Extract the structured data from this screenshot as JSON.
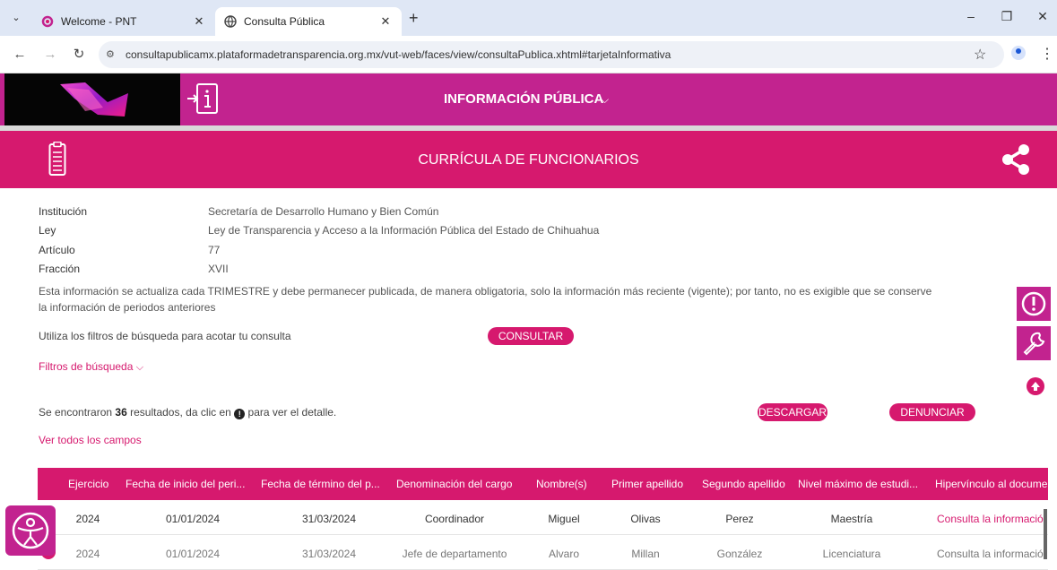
{
  "browser": {
    "tabs": [
      {
        "label": "Welcome - PNT",
        "active": false
      },
      {
        "label": "Consulta Pública",
        "active": true
      }
    ],
    "url": "consultapublicamx.plataformadetransparencia.org.mx/vut-web/faces/view/consultaPublica.xhtml#tarjetaInformativa"
  },
  "header": {
    "nav_label": "INFORMACIÓN PÚBLICA"
  },
  "banner": {
    "title": "CURRÍCULA DE FUNCIONARIOS"
  },
  "info": {
    "institucion_label": "Institución",
    "institucion_value": "Secretaría de Desarrollo Humano y Bien Común",
    "ley_label": "Ley",
    "ley_value": "Ley de Transparencia y Acceso a la Información Pública del Estado de Chihuahua",
    "articulo_label": "Artículo",
    "articulo_value": "77",
    "fraccion_label": "Fracción",
    "fraccion_value": "XVII",
    "note": "Esta información se actualiza cada TRIMESTRE y debe permanecer publicada, de manera obligatoria, solo la información más reciente (vigente); por tanto, no es exigible que se conserve la información de periodos anteriores"
  },
  "filters": {
    "hint": "Utiliza los filtros de búsqueda para acotar tu consulta",
    "consultar_label": "CONSULTAR",
    "toggle_label": "Filtros de búsqueda"
  },
  "results": {
    "prefix": "Se encontraron",
    "count": "36",
    "middle": "resultados, da clic en",
    "suffix": "para ver el detalle.",
    "descargar_label": "DESCARGAR",
    "denunciar_label": "DENUNCIAR",
    "ver_todos_label": "Ver todos los campos"
  },
  "table": {
    "headers": [
      "Ejercicio",
      "Fecha de inicio del peri...",
      "Fecha de término del p...",
      "Denominación del cargo",
      "Nombre(s)",
      "Primer apellido",
      "Segundo apellido",
      "Nivel máximo de estudi...",
      "Hipervínculo al docume..."
    ],
    "rows": [
      [
        "2024",
        "01/01/2024",
        "31/03/2024",
        "Coordinador",
        "Miguel",
        "Olivas",
        "Perez",
        "Maestría",
        "Consulta la información"
      ],
      [
        "2024",
        "01/01/2024",
        "31/03/2024",
        "Jefe de departamento",
        "Alvaro",
        "Millan",
        "González",
        "Licenciatura",
        "Consulta la información"
      ]
    ]
  },
  "colors": {
    "brand_magenta": "#c2238f",
    "accent_pink": "#d6196e"
  },
  "icons": [
    "chevron-down-icon",
    "login-info-icon",
    "document-list-icon",
    "share-icon",
    "alert-icon",
    "wrench-icon",
    "arrow-up-icon",
    "accessibility-icon",
    "info-icon"
  ]
}
